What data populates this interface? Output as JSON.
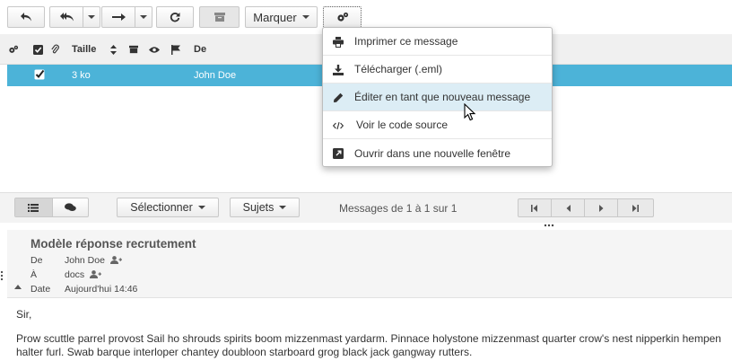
{
  "toolbar": {
    "reply_icon": "reply-icon",
    "reply_all_icon": "reply-all-icon",
    "forward_icon": "forward-icon",
    "refresh_icon": "refresh-icon",
    "archive_icon": "archive-icon",
    "mark_label": "Marquer",
    "more_icon": "gears-icon"
  },
  "list": {
    "columns": {
      "size": "Taille",
      "from": "De"
    },
    "rows": [
      {
        "size": "3 ko",
        "from": "John Doe",
        "selected": true
      }
    ]
  },
  "list_footer": {
    "select_label": "Sélectionner",
    "threads_label": "Sujets",
    "count_text": "Messages de 1 à 1 sur 1"
  },
  "menu": {
    "items": [
      {
        "label": "Imprimer ce message",
        "icon": "print-icon"
      },
      {
        "label": "Télécharger (.eml)",
        "icon": "download-icon"
      },
      {
        "label": "Éditer en tant que nouveau message",
        "icon": "pencil-icon",
        "highlighted": true
      },
      {
        "label": "Voir le code source",
        "icon": "code-icon"
      },
      {
        "label": "Ouvrir dans une nouvelle fenêtre",
        "icon": "external-window-icon"
      }
    ]
  },
  "message": {
    "subject": "Modèle réponse recrutement",
    "from_label": "De",
    "from_value": "John Doe",
    "to_label": "À",
    "to_value": "docs",
    "date_label": "Date",
    "date_value": "Aujourd'hui 14:46",
    "greeting": "Sir,",
    "body": "Prow scuttle parrel provost Sail ho shrouds spirits boom mizzenmast yardarm. Pinnace holystone mizzenmast quarter crow's nest nipperkin hempen halter furl. Swab barque interloper chantey doubloon starboard grog black jack gangway rutters."
  },
  "colors": {
    "selected_row": "#4cb3d8",
    "menu_highlight": "#dcedf5"
  }
}
